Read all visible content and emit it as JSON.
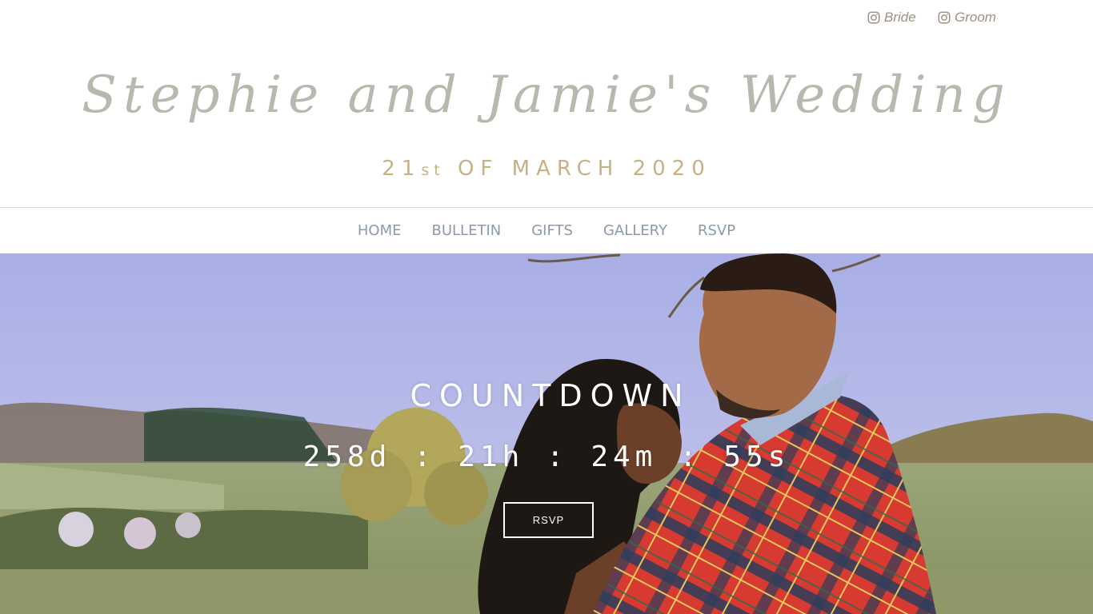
{
  "social": {
    "bride_label": "Bride",
    "groom_label": "Groom",
    "icon": "instagram-icon"
  },
  "header": {
    "title": "Stephie and Jamie's Wedding",
    "date_day": "21",
    "date_suffix": "st",
    "date_rest": "OF MARCH 2020"
  },
  "nav": {
    "items": [
      "HOME",
      "BULLETIN",
      "GIFTS",
      "GALLERY",
      "RSVP"
    ]
  },
  "hero": {
    "countdown_title": "COUNTDOWN",
    "countdown_value": "258d : 21h : 24m : 55s",
    "rsvp_button": "RSVP"
  },
  "colors": {
    "title": "#b8b9ae",
    "date": "#c6b284",
    "nav": "#8c9aab",
    "social": "#9c9384",
    "sky": "#b4b8e6",
    "grass": "#8f9b6c"
  }
}
